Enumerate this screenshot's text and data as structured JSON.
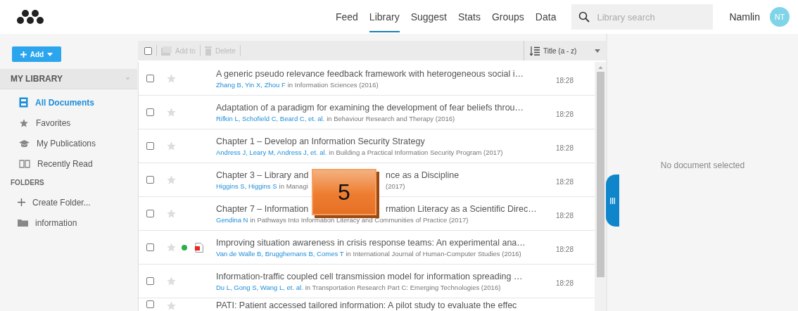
{
  "nav": {
    "items": [
      {
        "label": "Feed",
        "selected": false
      },
      {
        "label": "Library",
        "selected": true
      },
      {
        "label": "Suggest",
        "selected": false
      },
      {
        "label": "Stats",
        "selected": false
      },
      {
        "label": "Groups",
        "selected": false
      },
      {
        "label": "Data",
        "selected": false
      }
    ],
    "search": {
      "placeholder": "Library search"
    },
    "user": "Namlin",
    "avatar": "NT"
  },
  "sidebar": {
    "add_button": "Add",
    "section": "MY LIBRARY",
    "items": [
      {
        "label": "All Documents",
        "kind": "all",
        "selected": true
      },
      {
        "label": "Favorites",
        "kind": "star",
        "selected": false
      },
      {
        "label": "My Publications",
        "kind": "cap",
        "selected": false
      },
      {
        "label": "Recently Read",
        "kind": "book",
        "selected": false
      }
    ],
    "folders_heading": "FOLDERS",
    "folders": [
      {
        "label": "Create Folder...",
        "kind": "create"
      },
      {
        "label": "information",
        "kind": "folder"
      }
    ]
  },
  "toolbar": {
    "select_all_checked": false,
    "add_to": "Add to",
    "delete": "Delete",
    "sort": "Title (a - z)"
  },
  "documents": [
    {
      "title_parts": [
        "A generic pseudo relevance feedback framework with heterogeneous social i…"
      ],
      "authors": "Zhang B, Yin X, Zhou F",
      "venue_parts": [
        "in Information Sciences (2016)"
      ],
      "time": "18:28",
      "checked": false,
      "starred": false,
      "unread": false,
      "has_pdf": false
    },
    {
      "title_parts": [
        "Adaptation of a paradigm for examining the development of fear beliefs throu…"
      ],
      "authors": "Rifkin L, Schofield C, Beard C, et. al.",
      "venue_parts": [
        "in Behaviour Research and Therapy (2016)"
      ],
      "time": "18:28",
      "checked": false,
      "starred": false,
      "unread": false,
      "has_pdf": false
    },
    {
      "title_parts": [
        "Chapter 1 – Develop an Information Security Strategy"
      ],
      "authors": "Andress J, Leary M, Andress J, et. al.",
      "venue_parts": [
        "in Building a Practical Information Security Program (2017)"
      ],
      "time": "18:28",
      "checked": false,
      "starred": false,
      "unread": false,
      "has_pdf": false
    },
    {
      "title_parts": [
        "Chapter 3 – Library and",
        "nce as a Discipline"
      ],
      "authors": "Higgins S, Higgins S",
      "venue_parts": [
        "in Managi",
        "(2017)"
      ],
      "time": "18:28",
      "checked": false,
      "starred": false,
      "unread": false,
      "has_pdf": false
    },
    {
      "title_parts": [
        "Chapter 7 – Information",
        "rmation Literacy as a Scientific Direc…"
      ],
      "authors": "Gendina N",
      "venue_parts": [
        "in Pathways Into Information Literacy and Communities of Practice (2017)"
      ],
      "time": "18:28",
      "checked": false,
      "starred": false,
      "unread": false,
      "has_pdf": false
    },
    {
      "title_parts": [
        "Improving situation awareness in crisis response teams: An experimental ana…"
      ],
      "authors": "Van de Walle B, Brugghemans B, Comes T",
      "venue_parts": [
        "in International Journal of Human-Computer Studies (2016)"
      ],
      "time": "18:28",
      "checked": false,
      "starred": false,
      "unread": true,
      "has_pdf": true
    },
    {
      "title_parts": [
        "Information-traffic coupled cell transmission model for information spreading …"
      ],
      "authors": "Du L, Gong S, Wang L, et. al.",
      "venue_parts": [
        "in Transportation Research Part C: Emerging Technologies (2016)"
      ],
      "time": "18:28",
      "checked": false,
      "starred": false,
      "unread": false,
      "has_pdf": false
    },
    {
      "title_parts": [
        "PATI: Patient accessed tailored information: A pilot study to evaluate the effec"
      ],
      "checked": false,
      "starred": false,
      "unread": false,
      "has_pdf": false
    }
  ],
  "detail": {
    "empty_text": "No document selected"
  },
  "step_badge": "5"
}
